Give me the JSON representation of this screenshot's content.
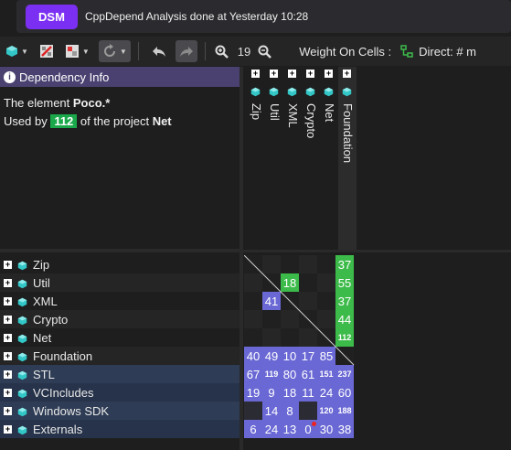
{
  "notification": {
    "badge": "DSM",
    "message": "CppDepend Analysis done at Yesterday 10:28"
  },
  "toolbar": {
    "zoom_value": "19",
    "weight_label": "Weight On Cells :",
    "direct_label": "Direct: # m"
  },
  "info": {
    "title": "Dependency Info",
    "line1_prefix": "The element ",
    "element_name": "Poco.*",
    "line2_prefix": "Used by ",
    "count": "112",
    "line2_mid": " of the project ",
    "project": "Net"
  },
  "columns": [
    "Zip",
    "Util",
    "XML",
    "Crypto",
    "Net",
    "Foundation"
  ],
  "rows": [
    "Zip",
    "Util",
    "XML",
    "Crypto",
    "Net",
    "Foundation",
    "STL",
    "VCIncludes",
    "Windows SDK",
    "Externals"
  ],
  "matrix": [
    [
      "",
      "",
      "",
      "",
      "",
      "37"
    ],
    [
      "",
      "",
      "18",
      "",
      "",
      "55"
    ],
    [
      "",
      "41",
      "",
      "",
      "",
      "37"
    ],
    [
      "",
      "",
      "",
      "",
      "",
      "44"
    ],
    [
      "",
      "",
      "",
      "",
      "",
      "112"
    ],
    [
      "40",
      "49",
      "10",
      "17",
      "85",
      ""
    ],
    [
      "67",
      "119",
      "80",
      "61",
      "151",
      "237"
    ],
    [
      "19",
      "9",
      "18",
      "11",
      "24",
      "60"
    ],
    [
      "",
      "14",
      "8",
      "",
      "120",
      "188"
    ],
    [
      "6",
      "24",
      "13",
      "0",
      "30",
      "38"
    ]
  ],
  "colors": {
    "green": "#3dbb4a",
    "blue": "#6a68d4",
    "purple_badge": "#7b2ff2",
    "cube": "#33c6c6"
  }
}
